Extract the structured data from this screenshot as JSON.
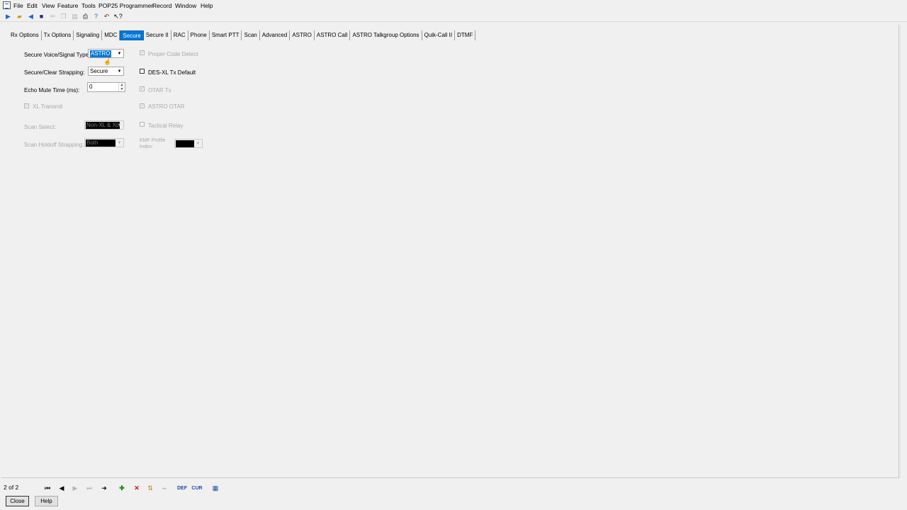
{
  "menu": [
    "File",
    "Edit",
    "View",
    "Feature",
    "Tools",
    "POP25 Programmer",
    "Record",
    "Window",
    "Help"
  ],
  "toolbar_icons": [
    "read-icon",
    "open-icon",
    "write-icon",
    "save-icon",
    "cut-icon",
    "copy-icon",
    "paste-icon",
    "print-icon",
    "help-icon",
    "back-icon",
    "whats-this-icon"
  ],
  "tabs": [
    "Rx Options",
    "Tx Options",
    "Signaling",
    "MDC",
    "Secure",
    "Secure II",
    "RAC",
    "Phone",
    "Smart PTT",
    "Scan",
    "Advanced",
    "ASTRO",
    "ASTRO Call",
    "ASTRO Talkgroup Options",
    "Quik-Call II",
    "DTMF"
  ],
  "active_tab": "Secure",
  "form": {
    "secure_voice_label": "Secure Voice/Signal Type:",
    "secure_voice_value": "ASTRO",
    "strapping_label": "Secure/Clear Strapping:",
    "strapping_value": "Secure",
    "echo_label": "Echo Mute Time (ms):",
    "echo_value": "0",
    "xl_transmit_label": "XL Transmit",
    "scan_select_label": "Scan Select:",
    "scan_select_value": "Non-XL & XL",
    "scan_holdoff_label": "Scan Holdoff Strapping:",
    "scan_holdoff_value": "Both",
    "proper_code_label": "Proper Code Detect",
    "desxl_label": "DES-XL Tx Default",
    "otar_tx_label": "OTAR Tx",
    "astro_otar_label": "ASTRO OTAR",
    "tactical_relay_label": "Tactical Relay",
    "kmf_label_line1": "KMF Profile",
    "kmf_label_line2": "Index:",
    "kmf_value": ""
  },
  "checkbox_states": {
    "xl_transmit": true,
    "proper_code": true,
    "desxl": false,
    "otar_tx": true,
    "astro_otar": true,
    "tactical_relay": false
  },
  "status": {
    "record_position": "2 of 2",
    "def_label": "DEF",
    "cur_label": "CUR"
  },
  "footer": {
    "close_label": "Close",
    "help_label": "Help"
  },
  "colors": {
    "accent": "#0078d7",
    "background": "#f0f0f0"
  }
}
